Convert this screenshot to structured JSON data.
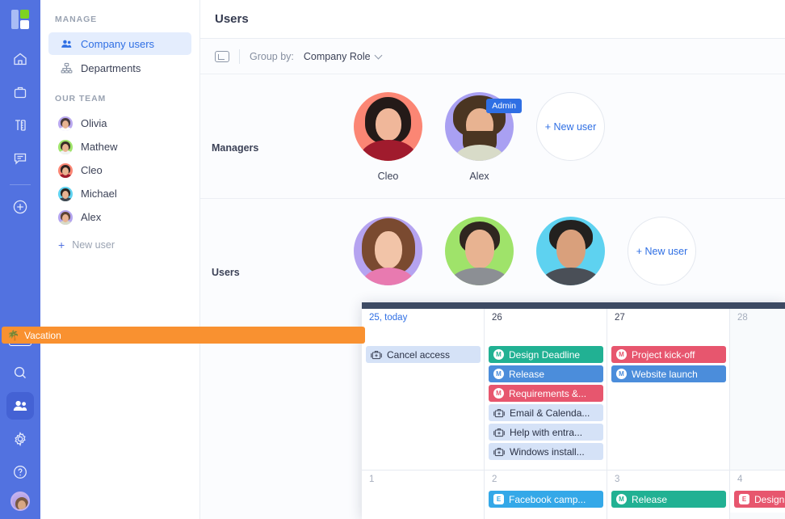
{
  "rail": {
    "logo_name": "app-logo",
    "items": [
      {
        "name": "home-icon",
        "label": "Home"
      },
      {
        "name": "briefcase-icon",
        "label": "Projects"
      },
      {
        "name": "tools-icon",
        "label": "Tools"
      },
      {
        "name": "chat-icon",
        "label": "Messages"
      },
      {
        "name": "plus-circle-icon",
        "label": "Create"
      }
    ],
    "pro_label": "PRO",
    "bottom_items": [
      {
        "name": "search-icon",
        "label": "Search"
      },
      {
        "name": "users-icon",
        "label": "Users"
      },
      {
        "name": "gear-icon",
        "label": "Settings"
      },
      {
        "name": "help-icon",
        "label": "Help"
      }
    ]
  },
  "sidebar": {
    "manage_title": "MANAGE",
    "manage_items": [
      {
        "label": "Company users",
        "icon": "users-icon",
        "selected": true
      },
      {
        "label": "Departments",
        "icon": "org-chart-icon",
        "selected": false
      }
    ],
    "team_title": "OUR TEAM",
    "team_members": [
      {
        "label": "Olivia",
        "bg": "#b9a8ef",
        "hair": "#4a3b3a"
      },
      {
        "label": "Mathew",
        "bg": "#9fe36a",
        "hair": "#3a2e28"
      },
      {
        "label": "Cleo",
        "bg": "#fb8674",
        "hair": "#2e2220"
      },
      {
        "label": "Michael",
        "bg": "#5ed2f0",
        "hair": "#2c2520"
      },
      {
        "label": "Alex",
        "bg": "#b3a4ee",
        "hair": "#5b4434"
      }
    ],
    "new_user_label": "New user"
  },
  "header": {
    "title": "Users"
  },
  "toolbar": {
    "expand_icon": "expand-icon",
    "group_by_label": "Group by:",
    "group_by_value": "Company Role"
  },
  "groups": [
    {
      "label": "Managers",
      "people": [
        {
          "name": "Cleo",
          "bg": "#fb8674",
          "hair": "#241a18",
          "skin": "#f0b79a",
          "body": "#a01b2d",
          "badge": null
        },
        {
          "name": "Alex",
          "bg": "#a9a0f2",
          "hair": "#4a3522",
          "skin": "#e8b391",
          "body": "#d8dbc8",
          "badge": "Admin"
        }
      ],
      "new_user_label": "+ New user"
    },
    {
      "label": "Users",
      "people": [
        {
          "name": "",
          "bg": "#b5a3f0",
          "hair": "#7a4a30",
          "skin": "#f2c4a8",
          "body": "#e87ab0",
          "badge": null
        },
        {
          "name": "",
          "bg": "#9fe36a",
          "hair": "#2f2620",
          "skin": "#e8b391",
          "body": "#8c8f94",
          "badge": null
        },
        {
          "name": "",
          "bg": "#5ed2f0",
          "hair": "#23211f",
          "skin": "#d9a07c",
          "body": "#4a4f57",
          "badge": null
        }
      ],
      "new_user_label": "+ New user"
    }
  ],
  "calendar": {
    "days": [
      {
        "num": "25",
        "suffix": ", today",
        "today": true,
        "dim": false
      },
      {
        "num": "26",
        "suffix": "",
        "today": false,
        "dim": false
      },
      {
        "num": "27",
        "suffix": "",
        "today": false,
        "dim": false
      },
      {
        "num": "28",
        "suffix": "",
        "today": false,
        "dim": true
      }
    ],
    "vacation": {
      "label": "Vacation",
      "icon": "palm-tree-icon",
      "color": "#f99130"
    },
    "col_25_events": [
      {
        "label": "Cancel access",
        "style": "light",
        "icon": "toolbox-icon"
      }
    ],
    "col_26_events": [
      {
        "label": "Design Deadline",
        "style": "teal",
        "icon": "milestone-icon",
        "letter": "M"
      },
      {
        "label": "Release",
        "style": "blue",
        "icon": "milestone-icon",
        "letter": "M"
      },
      {
        "label": "Requirements &...",
        "style": "pink",
        "icon": "milestone-icon",
        "letter": "M"
      },
      {
        "label": "Email & Calenda...",
        "style": "light",
        "icon": "toolbox-icon"
      },
      {
        "label": "Help with entra...",
        "style": "light",
        "icon": "toolbox-icon"
      },
      {
        "label": "Windows install...",
        "style": "light",
        "icon": "toolbox-icon"
      }
    ],
    "col_27_events": [
      {
        "label": "Project kick-off",
        "style": "pink",
        "icon": "milestone-icon",
        "letter": "M"
      },
      {
        "label": "Website launch",
        "style": "blue",
        "icon": "milestone-icon",
        "letter": "M"
      }
    ],
    "col_28_events": [],
    "days_row2": [
      {
        "num": "1",
        "dim": true
      },
      {
        "num": "2",
        "dim": true
      },
      {
        "num": "3",
        "dim": true
      },
      {
        "num": "4",
        "dim": true
      }
    ],
    "row2_col1_events": [],
    "row2_col2_events": [
      {
        "label": "Facebook camp...",
        "style": "skyblue",
        "icon": "event-icon",
        "letter": "E"
      }
    ],
    "row2_col3_events": [
      {
        "label": "Release",
        "style": "teal",
        "icon": "milestone-icon",
        "letter": "M"
      }
    ],
    "row2_col4_events": [
      {
        "label": "Design",
        "style": "pink",
        "icon": "event-icon",
        "letter": "E"
      }
    ]
  },
  "colors": {
    "brand": "#5272e0",
    "accent_link": "#2f6fe4",
    "selected_bg": "#e4edfd",
    "vacation": "#f99130",
    "teal": "#21b193",
    "blue": "#4b8ddb",
    "pink": "#e7566e",
    "skyblue": "#34a8e8",
    "chip_light": "#d5e2f7",
    "cal_topbar": "#3d4a63"
  }
}
